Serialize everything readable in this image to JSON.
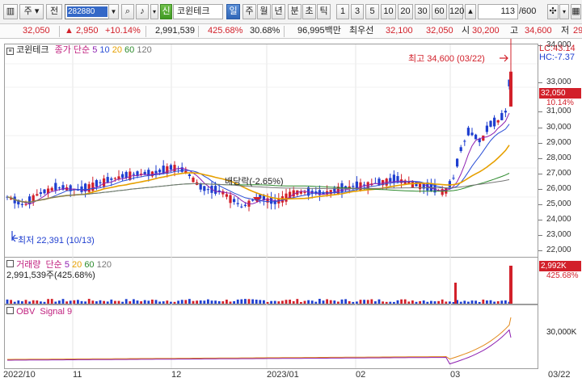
{
  "toolbar": {
    "period_label": "주",
    "prev_label": "전",
    "code_value": "282880",
    "badge_label": "신",
    "stock_name": "코윈테크",
    "period_tabs": [
      "일",
      "주",
      "월",
      "년",
      "분",
      "초",
      "틱"
    ],
    "active_tab": "일",
    "minute_steps": [
      "1",
      "3",
      "5",
      "10",
      "20",
      "30",
      "60",
      "120"
    ],
    "page_counter": "113",
    "page_total": "/600"
  },
  "price_bar": {
    "price": "32,050",
    "change": "▲ 2,950",
    "change_pct": "+10.14%",
    "volume": "2,991,539",
    "volume_ratio": "425.68%",
    "turnover": "30.68%",
    "amount": "96,995백만",
    "ask_label": "최우선",
    "ask": "32,100",
    "bid": "32,050",
    "open_label": "시",
    "open": "30,200",
    "high_label": "고",
    "high": "34,600",
    "low_label": "저",
    "low": "29"
  },
  "main_panel": {
    "stock_label": "코윈테크",
    "ma_label": "종가 단순",
    "ma_periods": [
      {
        "label": "5",
        "color": "#8d1fb0"
      },
      {
        "label": "10",
        "color": "#2b4fd6"
      },
      {
        "label": "20",
        "color": "#e6a000"
      },
      {
        "label": "60",
        "color": "#2c8a2c"
      },
      {
        "label": "120",
        "color": "#777777"
      }
    ],
    "lc_label": "LC:43.14",
    "hc_label": "HC:-7.37",
    "high_annotation": "최고 34,600 (03/22)",
    "low_annotation": "최저 22,391 (10/13)",
    "dividend_annotation": "배당락(-2.65%)",
    "y_ticks": [
      "34,000",
      "33,000",
      "31,000",
      "30,000",
      "29,000",
      "28,000",
      "27,000",
      "26,000",
      "25,000",
      "24,000",
      "23,000",
      "22,000"
    ],
    "current_price_tag": "32,050",
    "current_pct_tag": "10.14%"
  },
  "volume_panel": {
    "label": "거래량",
    "ma_label": "단순",
    "ma_periods": [
      {
        "label": "5",
        "color": "#8d1fb0"
      },
      {
        "label": "20",
        "color": "#e6a000"
      },
      {
        "label": "60",
        "color": "#2c8a2c"
      },
      {
        "label": "120",
        "color": "#777777"
      }
    ],
    "value_text": "2,991,539주(425.68%)",
    "tag_value": "2,992K",
    "tag_pct": "425.68%"
  },
  "obv_panel": {
    "label": "OBV",
    "signal_label": "Signal 9",
    "y_tick": "30,000K"
  },
  "x_axis": [
    "2022/10",
    "11",
    "12",
    "2023/01",
    "02",
    "03",
    "03/22"
  ],
  "colors": {
    "up": "#d2202a",
    "down": "#1f3fd0",
    "ma5": "#8d1fb0",
    "ma10": "#2b4fd6",
    "ma20": "#e6a000",
    "ma60": "#2c8a2c",
    "ma120": "#777777"
  }
}
